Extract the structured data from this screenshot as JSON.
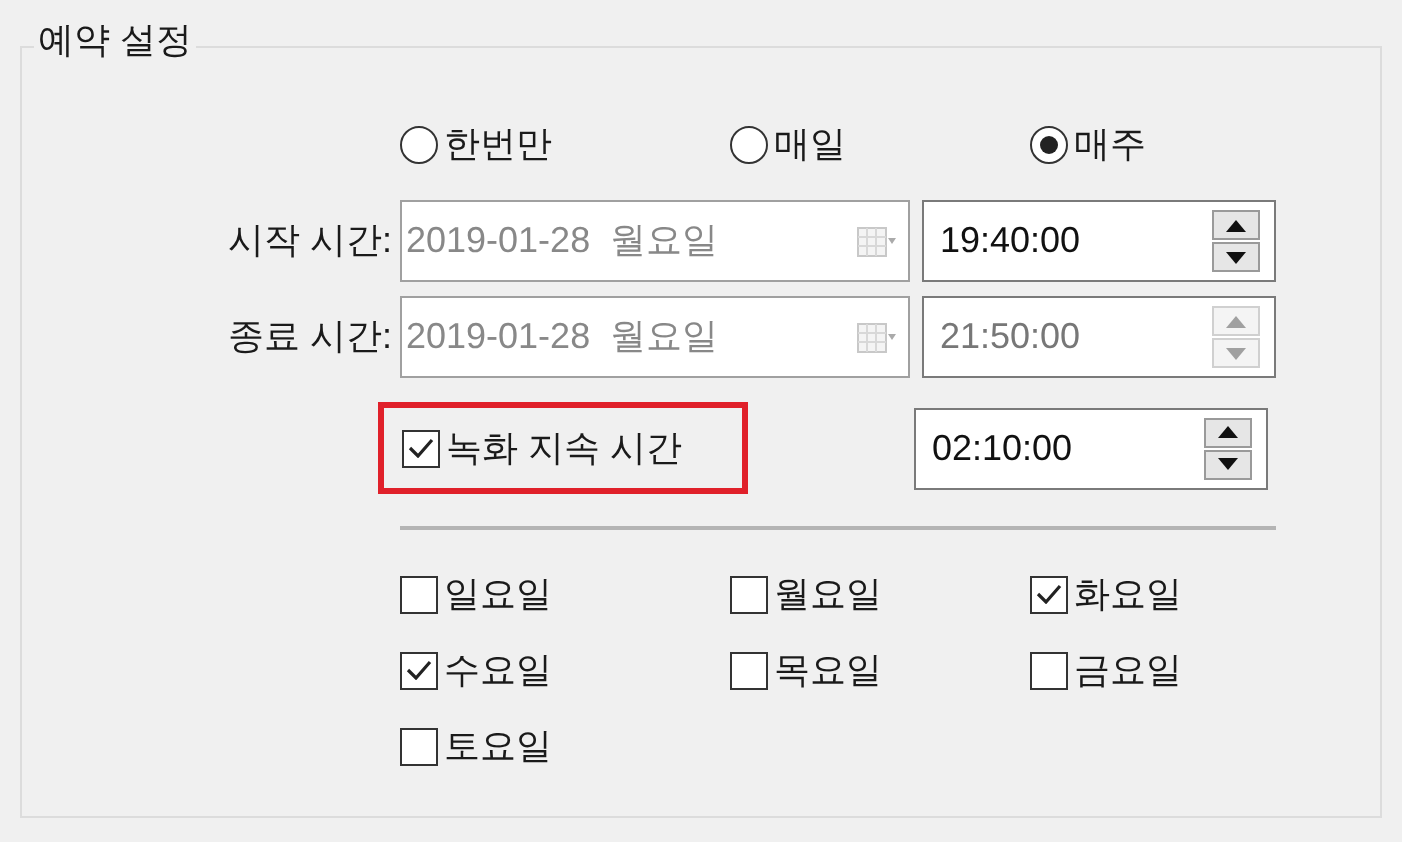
{
  "group": {
    "title": "예약 설정"
  },
  "repeat_options": [
    {
      "label": "한번만",
      "selected": false
    },
    {
      "label": "매일",
      "selected": false
    },
    {
      "label": "매주",
      "selected": true
    }
  ],
  "time_rows": [
    {
      "label": "시작 시간:",
      "date": "2019-01-28  월요일",
      "time": "19:40:00",
      "date_disabled": true,
      "time_disabled": false
    },
    {
      "label": "종료 시간:",
      "date": "2019-01-28  월요일",
      "time": "21:50:00",
      "date_disabled": true,
      "time_disabled": true
    }
  ],
  "duration": {
    "label": "녹화 지속 시간",
    "checked": true,
    "highlighted": true,
    "time": "02:10:00",
    "disabled": false
  },
  "weekdays": [
    {
      "label": "일요일",
      "checked": false
    },
    {
      "label": "월요일",
      "checked": false
    },
    {
      "label": "화요일",
      "checked": true
    },
    {
      "label": "수요일",
      "checked": true
    },
    {
      "label": "목요일",
      "checked": false
    },
    {
      "label": "금요일",
      "checked": false
    },
    {
      "label": "토요일",
      "checked": false
    }
  ]
}
